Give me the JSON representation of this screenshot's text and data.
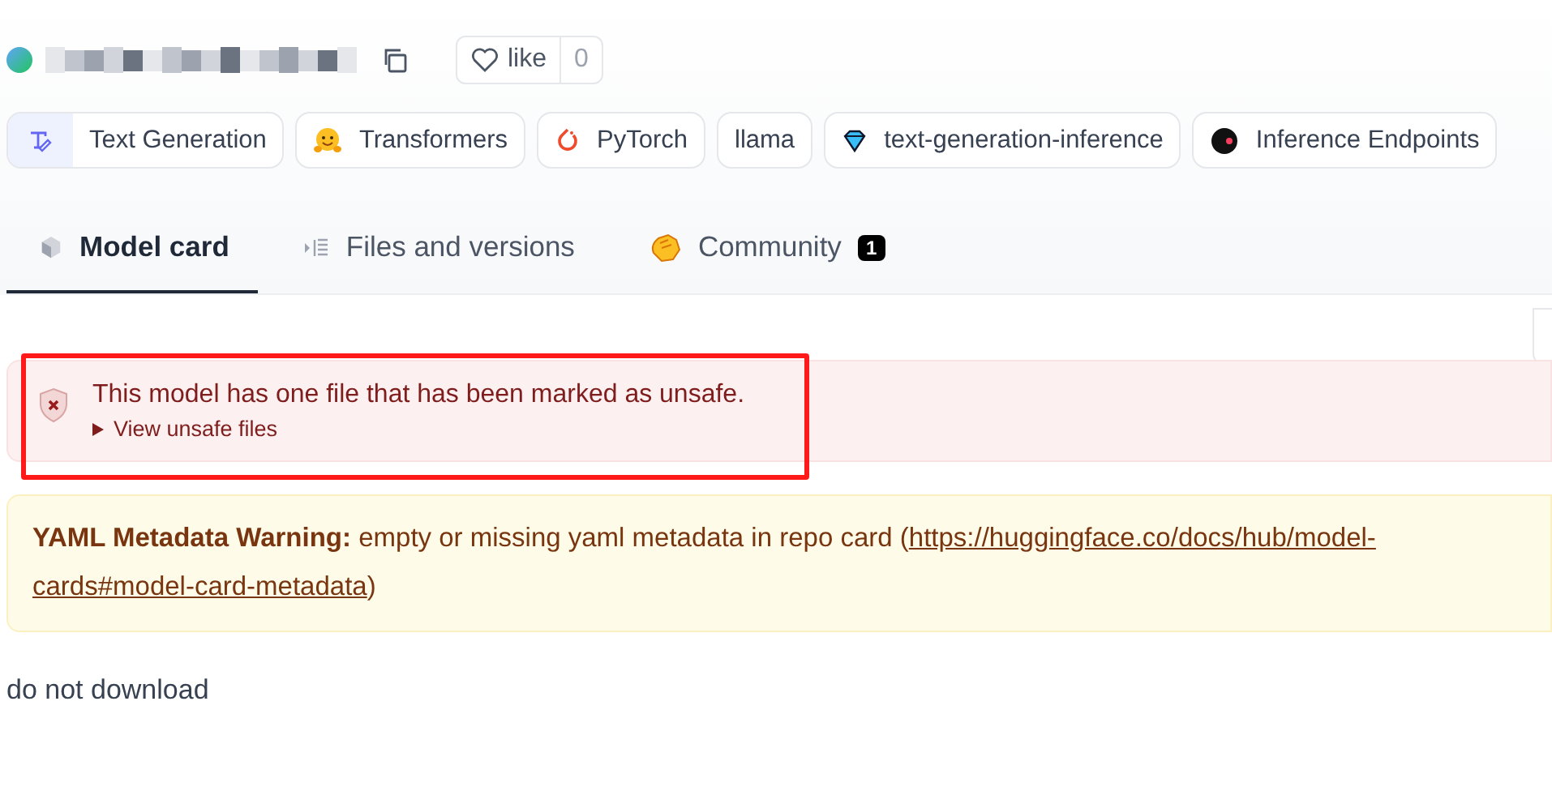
{
  "repo": {
    "like_label": "like",
    "like_count": "0"
  },
  "tags": [
    {
      "kind": "task",
      "label": "Text Generation"
    },
    {
      "kind": "hug",
      "label": "Transformers"
    },
    {
      "kind": "torch",
      "label": "PyTorch"
    },
    {
      "kind": "plain",
      "label": "llama"
    },
    {
      "kind": "gem",
      "label": "text-generation-inference"
    },
    {
      "kind": "endpoint",
      "label": "Inference Endpoints"
    }
  ],
  "tabs": [
    {
      "kind": "cube",
      "label": "Model card",
      "selected": true
    },
    {
      "kind": "files",
      "label": "Files and versions",
      "selected": false
    },
    {
      "kind": "hands",
      "label": "Community",
      "selected": false,
      "badge": "1"
    }
  ],
  "unsafe_alert": {
    "message": "This model has one file that has been marked as unsafe.",
    "toggle": "View unsafe files",
    "expanded": false
  },
  "yaml_warning": {
    "label": "YAML Metadata Warning:",
    "text": "empty or missing yaml metadata in repo card (",
    "link_line_1": "https://huggingface.co/docs/hub/model-",
    "link_line_2": "cards#model-card-metadata",
    "closing": ")"
  },
  "body_text": "do not download"
}
